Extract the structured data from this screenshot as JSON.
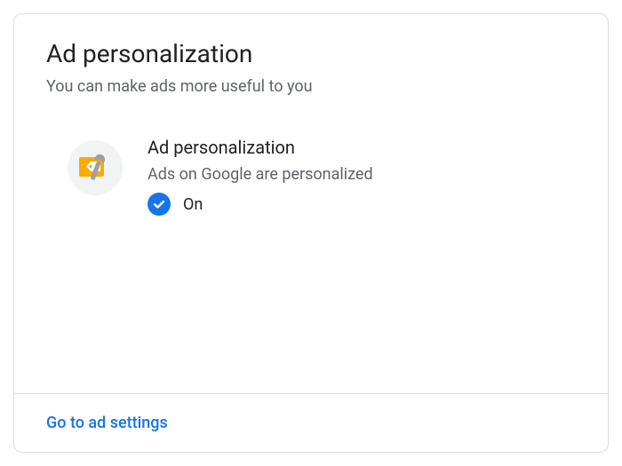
{
  "card": {
    "title": "Ad personalization",
    "subtitle": "You can make ads more useful to you",
    "item": {
      "title": "Ad personalization",
      "description": "Ads on Google are personalized",
      "status_label": "On",
      "status_badge_color": "#1a73e8",
      "icon": "price-tag-wrench-icon"
    },
    "footer_link": "Go to ad settings"
  }
}
